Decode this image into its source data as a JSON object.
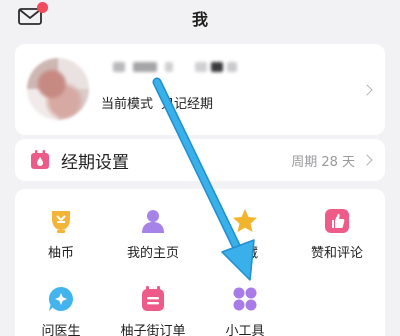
{
  "header": {
    "title": "我",
    "mail_icon": "mail-icon",
    "notification_color": "#f24b5d"
  },
  "profile": {
    "mode_label": "当前模式",
    "mode_value": "只记经期",
    "chevron_icon": "chevron-right-icon"
  },
  "period_settings": {
    "label": "经期设置",
    "value": "周期 28 天",
    "icon": "calendar-drop-icon",
    "icon_color": "#ec5a87"
  },
  "tools": {
    "items": [
      {
        "label": "柚币",
        "icon": "coin-cup-icon",
        "color": "#f3b437"
      },
      {
        "label": "我的主页",
        "icon": "person-icon",
        "color": "#a683e6"
      },
      {
        "label": "收藏",
        "icon": "star-icon",
        "color": "#f2b32d"
      },
      {
        "label": "赞和评论",
        "icon": "thumbs-up-icon",
        "color": "#ef5b88"
      },
      {
        "label": "问医生",
        "icon": "chat-bubble-icon",
        "color": "#44b4ef"
      },
      {
        "label": "柚子街订单",
        "icon": "order-calendar-icon",
        "color": "#ef5b88"
      },
      {
        "label": "小工具",
        "icon": "tools-grid-icon",
        "color": "#a87be8"
      }
    ]
  },
  "annotation": {
    "arrow_color": "#3ab0ea"
  }
}
